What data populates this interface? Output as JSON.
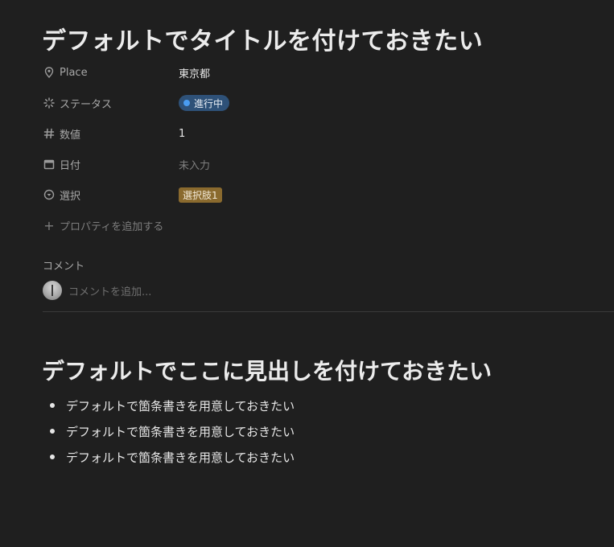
{
  "page": {
    "title": "デフォルトでタイトルを付けておきたい"
  },
  "properties": [
    {
      "icon": "map-pin-icon",
      "label": "Place",
      "value": "東京都",
      "kind": "text"
    },
    {
      "icon": "status-spinner-icon",
      "label": "ステータス",
      "value": "進行中",
      "kind": "status",
      "color": "#2e5178",
      "dot_color": "#4a9cf0"
    },
    {
      "icon": "hash-icon",
      "label": "数値",
      "value": "1",
      "kind": "number"
    },
    {
      "icon": "calendar-icon",
      "label": "日付",
      "value": "未入力",
      "kind": "empty"
    },
    {
      "icon": "select-circle-icon",
      "label": "選択",
      "value": "選択肢1",
      "kind": "select",
      "color": "#8a6a2e"
    }
  ],
  "add_property": {
    "label": "プロパティを追加する"
  },
  "comments": {
    "heading": "コメント",
    "placeholder": "コメントを追加..."
  },
  "content": {
    "heading": "デフォルトでここに見出しを付けておきたい",
    "bullets": [
      "デフォルトで箇条書きを用意しておきたい",
      "デフォルトで箇条書きを用意しておきたい",
      "デフォルトで箇条書きを用意しておきたい"
    ]
  }
}
